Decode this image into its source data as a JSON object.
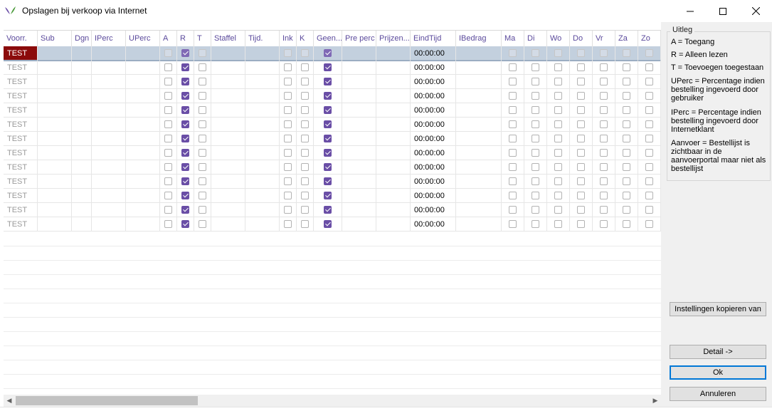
{
  "window": {
    "title": "Opslagen bij verkoop via Internet",
    "minimize_glyph": "—",
    "maximize_glyph": "☐",
    "close_glyph": "✕"
  },
  "columns": [
    "Voorr.",
    "Sub",
    "Dgn",
    "IPerc",
    "UPerc",
    "A",
    "R",
    "T",
    "Staffel",
    "Tijd.",
    "Ink",
    "K",
    "Geen...",
    "Pre perc",
    "Prijzen...",
    "EindTijd",
    "IBedrag",
    "Ma",
    "Di",
    "Wo",
    "Do",
    "Vr",
    "Za",
    "Zo",
    ""
  ],
  "rows": [
    {
      "name": "TEST",
      "eindtijd": "00:00:00",
      "A": false,
      "R": true,
      "T": false,
      "Ink": false,
      "K": false,
      "Geen": true
    },
    {
      "name": "TEST",
      "eindtijd": "00:00:00",
      "A": false,
      "R": true,
      "T": false,
      "Ink": false,
      "K": false,
      "Geen": true
    },
    {
      "name": "TEST",
      "eindtijd": "00:00:00",
      "A": false,
      "R": true,
      "T": false,
      "Ink": false,
      "K": false,
      "Geen": true
    },
    {
      "name": "TEST",
      "eindtijd": "00:00:00",
      "A": false,
      "R": true,
      "T": false,
      "Ink": false,
      "K": false,
      "Geen": true
    },
    {
      "name": "TEST",
      "eindtijd": "00:00:00",
      "A": false,
      "R": true,
      "T": false,
      "Ink": false,
      "K": false,
      "Geen": true
    },
    {
      "name": "TEST",
      "eindtijd": "00:00:00",
      "A": false,
      "R": true,
      "T": false,
      "Ink": false,
      "K": false,
      "Geen": true
    },
    {
      "name": "TEST",
      "eindtijd": "00:00:00",
      "A": false,
      "R": true,
      "T": false,
      "Ink": false,
      "K": false,
      "Geen": true
    },
    {
      "name": "TEST",
      "eindtijd": "00:00:00",
      "A": false,
      "R": true,
      "T": false,
      "Ink": false,
      "K": false,
      "Geen": true
    },
    {
      "name": "TEST",
      "eindtijd": "00:00:00",
      "A": false,
      "R": true,
      "T": false,
      "Ink": false,
      "K": false,
      "Geen": true
    },
    {
      "name": "TEST",
      "eindtijd": "00:00:00",
      "A": false,
      "R": true,
      "T": false,
      "Ink": false,
      "K": false,
      "Geen": true
    },
    {
      "name": "TEST",
      "eindtijd": "00:00:00",
      "A": false,
      "R": true,
      "T": false,
      "Ink": false,
      "K": false,
      "Geen": true
    },
    {
      "name": "TEST",
      "eindtijd": "00:00:00",
      "A": false,
      "R": true,
      "T": false,
      "Ink": false,
      "K": false,
      "Geen": true
    },
    {
      "name": "TEST",
      "eindtijd": "00:00:00",
      "A": false,
      "R": true,
      "T": false,
      "Ink": false,
      "K": false,
      "Geen": true
    }
  ],
  "selected_row": 0,
  "uitleg": {
    "title": "Uitleg",
    "lines": [
      "A = Toegang",
      "R = Alleen lezen",
      "T = Toevoegen toegestaan",
      "UPerc = Percentage indien bestelling ingevoerd door gebruiker",
      "IPerc = Percentage indien bestelling ingevoerd door Internetklant",
      "Aanvoer = Bestellijst is zichtbaar in de aanvoerportal maar niet als bestellijst"
    ]
  },
  "buttons": {
    "copy_settings": "Instellingen kopieren van",
    "detail": "Detail ->",
    "ok": "Ok",
    "cancel": "Annuleren"
  },
  "scrollbar": {
    "left_arrow": "◀",
    "right_arrow": "▶"
  },
  "colors": {
    "accent_purple": "#6a4ea6",
    "header_text": "#5b4a9c",
    "selected_name_bg": "#8b0b0b",
    "selected_row_bg": "#c3d0de",
    "logo_green": "#4a9a3a",
    "logo_purple": "#6a4ea6"
  }
}
